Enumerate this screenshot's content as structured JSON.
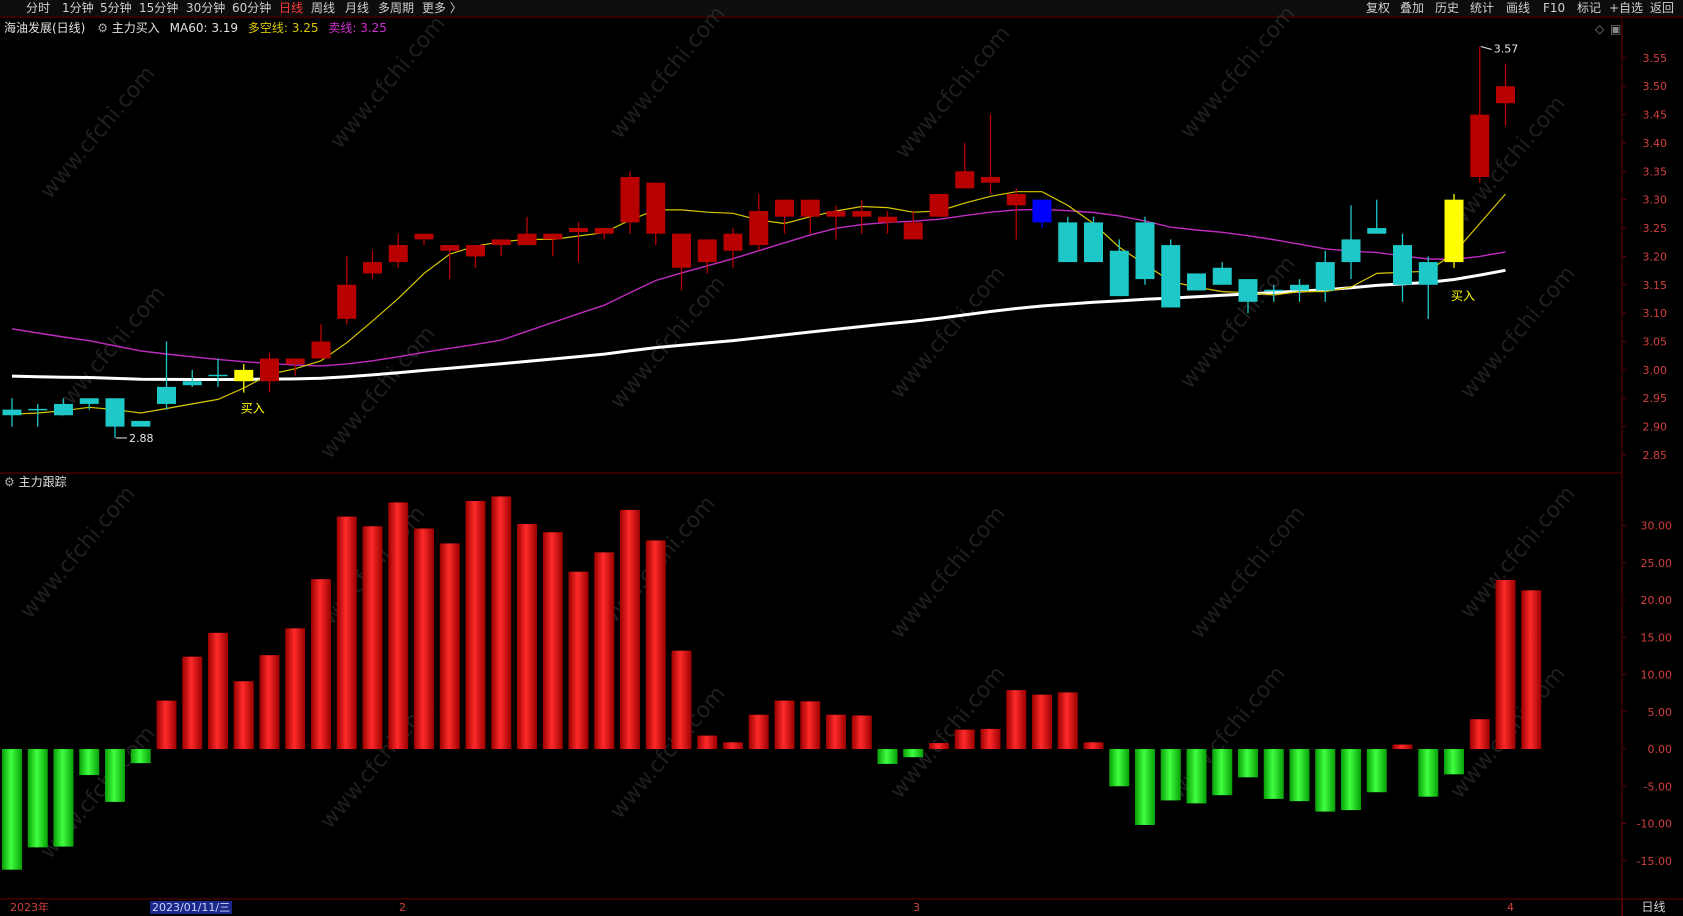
{
  "toolbar": {
    "periods": [
      "分时",
      "1分钟",
      "5分钟",
      "15分钟",
      "30分钟",
      "60分钟",
      "日线",
      "周线",
      "月线",
      "多周期",
      "更多 〉"
    ],
    "active_period": "日线",
    "right_buttons": [
      "复权",
      "叠加",
      "历史",
      "统计",
      "画线",
      "F10",
      "标记",
      "+自选",
      "返回"
    ]
  },
  "main": {
    "stock_name": "海油发展(日线)",
    "indicator_name": "主力买入",
    "ma60_label": "MA60:",
    "ma60_value": "3.19",
    "duokong_label": "多空线:",
    "duokong_value": "3.25",
    "maixian_label": "卖线:",
    "maixian_value": "3.25",
    "high_marker": "3.57",
    "low_marker": "2.88",
    "buy_label": "买入",
    "y_ticks": [
      "3.55",
      "3.50",
      "3.45",
      "3.40",
      "3.35",
      "3.30",
      "3.25",
      "3.20",
      "3.15",
      "3.10",
      "3.05",
      "3.00",
      "2.95",
      "2.90",
      "2.85"
    ]
  },
  "sub": {
    "indicator_name": "主力跟踪",
    "y_ticks": [
      "30.00",
      "25.00",
      "20.00",
      "15.00",
      "10.00",
      "5.00",
      "0.00",
      "-5.00",
      "-10.00",
      "-15.00"
    ]
  },
  "xaxis": {
    "year_label": "2023年",
    "cursor_date": "2023/01/11/三",
    "month2": "2",
    "month3": "3",
    "month4": "4"
  },
  "period_label": "日线",
  "watermark": "www.cfchi.com",
  "colors": {
    "up": "#b80000",
    "down": "#1fc8c8",
    "yellow_buy": "#ffff00",
    "blue_sell": "#0000ff",
    "ma_white": "#ffffff",
    "ma_magenta": "#c02cc0",
    "ma_yellow": "#d8c800",
    "bar_red": "#e00000",
    "bar_green": "#10d010",
    "grid_red": "#6a0000"
  },
  "candles": [
    {
      "o": 2.92,
      "h": 2.95,
      "l": 2.9,
      "c": 2.93,
      "k": "down"
    },
    {
      "o": 2.93,
      "h": 2.94,
      "l": 2.9,
      "c": 2.93,
      "k": "cross"
    },
    {
      "o": 2.92,
      "h": 2.95,
      "l": 2.92,
      "c": 2.94,
      "k": "down"
    },
    {
      "o": 2.94,
      "h": 2.95,
      "l": 2.93,
      "c": 2.95,
      "k": "down"
    },
    {
      "o": 2.95,
      "h": 2.95,
      "l": 2.88,
      "c": 2.9,
      "k": "down"
    },
    {
      "o": 2.91,
      "h": 2.91,
      "l": 2.9,
      "c": 2.9,
      "k": "down"
    },
    {
      "o": 2.94,
      "h": 3.05,
      "l": 2.93,
      "c": 2.97,
      "k": "down"
    },
    {
      "o": 2.98,
      "h": 3.0,
      "l": 2.97,
      "c": 2.98,
      "k": "down"
    },
    {
      "o": 2.99,
      "h": 3.02,
      "l": 2.97,
      "c": 2.99,
      "k": "cross"
    },
    {
      "o": 2.98,
      "h": 3.01,
      "l": 2.96,
      "c": 3.0,
      "k": "yellow"
    },
    {
      "o": 2.98,
      "h": 3.03,
      "l": 2.96,
      "c": 3.02,
      "k": "up"
    },
    {
      "o": 3.01,
      "h": 3.02,
      "l": 2.99,
      "c": 3.02,
      "k": "up"
    },
    {
      "o": 3.02,
      "h": 3.08,
      "l": 3.02,
      "c": 3.05,
      "k": "up"
    },
    {
      "o": 3.09,
      "h": 3.2,
      "l": 3.08,
      "c": 3.15,
      "k": "up"
    },
    {
      "o": 3.17,
      "h": 3.21,
      "l": 3.16,
      "c": 3.19,
      "k": "up"
    },
    {
      "o": 3.19,
      "h": 3.24,
      "l": 3.18,
      "c": 3.22,
      "k": "up"
    },
    {
      "o": 3.23,
      "h": 3.24,
      "l": 3.22,
      "c": 3.24,
      "k": "up"
    },
    {
      "o": 3.21,
      "h": 3.22,
      "l": 3.16,
      "c": 3.22,
      "k": "up"
    },
    {
      "o": 3.2,
      "h": 3.22,
      "l": 3.18,
      "c": 3.22,
      "k": "up"
    },
    {
      "o": 3.22,
      "h": 3.23,
      "l": 3.2,
      "c": 3.23,
      "k": "up"
    },
    {
      "o": 3.22,
      "h": 3.27,
      "l": 3.22,
      "c": 3.24,
      "k": "up"
    },
    {
      "o": 3.23,
      "h": 3.24,
      "l": 3.2,
      "c": 3.24,
      "k": "up"
    },
    {
      "o": 3.25,
      "h": 3.26,
      "l": 3.19,
      "c": 3.25,
      "k": "up"
    },
    {
      "o": 3.24,
      "h": 3.25,
      "l": 3.23,
      "c": 3.25,
      "k": "up"
    },
    {
      "o": 3.26,
      "h": 3.35,
      "l": 3.24,
      "c": 3.34,
      "k": "up"
    },
    {
      "o": 3.24,
      "h": 3.33,
      "l": 3.22,
      "c": 3.33,
      "k": "up"
    },
    {
      "o": 3.18,
      "h": 3.24,
      "l": 3.14,
      "c": 3.24,
      "k": "up"
    },
    {
      "o": 3.19,
      "h": 3.23,
      "l": 3.17,
      "c": 3.23,
      "k": "up"
    },
    {
      "o": 3.21,
      "h": 3.25,
      "l": 3.18,
      "c": 3.24,
      "k": "up"
    },
    {
      "o": 3.22,
      "h": 3.31,
      "l": 3.21,
      "c": 3.28,
      "k": "up"
    },
    {
      "o": 3.27,
      "h": 3.3,
      "l": 3.24,
      "c": 3.3,
      "k": "up"
    },
    {
      "o": 3.27,
      "h": 3.3,
      "l": 3.24,
      "c": 3.3,
      "k": "up"
    },
    {
      "o": 3.27,
      "h": 3.29,
      "l": 3.23,
      "c": 3.28,
      "k": "up"
    },
    {
      "o": 3.27,
      "h": 3.3,
      "l": 3.24,
      "c": 3.28,
      "k": "up"
    },
    {
      "o": 3.26,
      "h": 3.28,
      "l": 3.24,
      "c": 3.27,
      "k": "up"
    },
    {
      "o": 3.23,
      "h": 3.28,
      "l": 3.23,
      "c": 3.26,
      "k": "up"
    },
    {
      "o": 3.27,
      "h": 3.31,
      "l": 3.27,
      "c": 3.31,
      "k": "up"
    },
    {
      "o": 3.32,
      "h": 3.4,
      "l": 3.32,
      "c": 3.35,
      "k": "up"
    },
    {
      "o": 3.33,
      "h": 3.45,
      "l": 3.31,
      "c": 3.34,
      "k": "up"
    },
    {
      "o": 3.29,
      "h": 3.32,
      "l": 3.23,
      "c": 3.31,
      "k": "up"
    },
    {
      "o": 3.3,
      "h": 3.3,
      "l": 3.25,
      "c": 3.26,
      "k": "blue"
    },
    {
      "o": 3.26,
      "h": 3.27,
      "l": 3.19,
      "c": 3.19,
      "k": "down"
    },
    {
      "o": 3.26,
      "h": 3.27,
      "l": 3.19,
      "c": 3.19,
      "k": "down"
    },
    {
      "o": 3.21,
      "h": 3.23,
      "l": 3.13,
      "c": 3.13,
      "k": "down"
    },
    {
      "o": 3.26,
      "h": 3.27,
      "l": 3.15,
      "c": 3.16,
      "k": "down"
    },
    {
      "o": 3.22,
      "h": 3.23,
      "l": 3.11,
      "c": 3.11,
      "k": "down"
    },
    {
      "o": 3.17,
      "h": 3.17,
      "l": 3.14,
      "c": 3.14,
      "k": "down"
    },
    {
      "o": 3.18,
      "h": 3.19,
      "l": 3.15,
      "c": 3.15,
      "k": "down"
    },
    {
      "o": 3.16,
      "h": 3.16,
      "l": 3.1,
      "c": 3.12,
      "k": "down"
    },
    {
      "o": 3.14,
      "h": 3.15,
      "l": 3.12,
      "c": 3.14,
      "k": "cross"
    },
    {
      "o": 3.15,
      "h": 3.16,
      "l": 3.12,
      "c": 3.14,
      "k": "down"
    },
    {
      "o": 3.19,
      "h": 3.21,
      "l": 3.12,
      "c": 3.14,
      "k": "down"
    },
    {
      "o": 3.23,
      "h": 3.29,
      "l": 3.16,
      "c": 3.19,
      "k": "down"
    },
    {
      "o": 3.25,
      "h": 3.3,
      "l": 3.24,
      "c": 3.24,
      "k": "down"
    },
    {
      "o": 3.22,
      "h": 3.24,
      "l": 3.12,
      "c": 3.15,
      "k": "down"
    },
    {
      "o": 3.19,
      "h": 3.2,
      "l": 3.09,
      "c": 3.15,
      "k": "down"
    },
    {
      "o": 3.19,
      "h": 3.31,
      "l": 3.18,
      "c": 3.3,
      "k": "yellow"
    },
    {
      "o": 3.34,
      "h": 3.57,
      "l": 3.33,
      "c": 3.45,
      "k": "up"
    },
    {
      "o": 3.47,
      "h": 3.54,
      "l": 3.43,
      "c": 3.5,
      "k": "up"
    }
  ],
  "bars": [
    -16.2,
    -13.2,
    -13.1,
    -3.5,
    -7.1,
    -1.9,
    6.5,
    12.4,
    15.6,
    9.1,
    12.6,
    16.2,
    22.8,
    31.2,
    29.9,
    33.1,
    29.6,
    27.6,
    33.3,
    33.9,
    30.2,
    29.1,
    23.8,
    26.4,
    32.1,
    28.0,
    13.2,
    1.8,
    0.9,
    4.6,
    6.5,
    6.4,
    4.6,
    4.5,
    -2.0,
    -1.1,
    0.8,
    2.6,
    2.7,
    7.9,
    7.3,
    7.6,
    0.9,
    -5.0,
    -10.2,
    -6.9,
    -7.3,
    -6.2,
    -3.8,
    -6.7,
    -7.0,
    -8.4,
    -8.2,
    -5.8,
    0.6,
    -6.4,
    -3.4,
    4.0,
    22.7,
    21.3
  ]
}
